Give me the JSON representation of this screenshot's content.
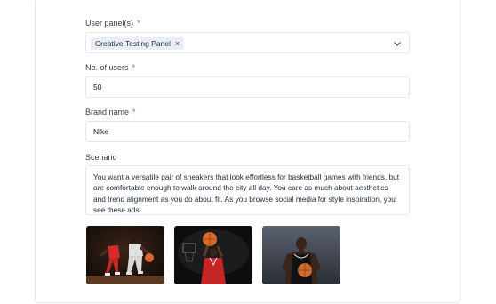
{
  "form": {
    "user_panels": {
      "label": "User panel(s)",
      "chip": "Creative Testing Panel",
      "chip_remove": "×"
    },
    "num_users": {
      "label": "No. of users",
      "value": "50"
    },
    "brand": {
      "label": "Brand name",
      "value": "Nike"
    },
    "scenario": {
      "label": "Scenario",
      "value": "You want a versatile pair of sneakers that look effortless for basketball games with friends, but are comfortable enough to walk around the city all day. You care as much about aesthetics and trend alignment as you do about fit. As you browse social media for style inspiration, you see these ads."
    },
    "required_marker": "*"
  },
  "images": [
    {
      "name": "basketball-players-red-ad-image"
    },
    {
      "name": "basketball-shooter-ad-image"
    },
    {
      "name": "basketball-player-portrait-ad-image"
    }
  ],
  "colors": {
    "required": "#ef4444",
    "chip_bg": "#e8edf6",
    "border": "#e5e7eb"
  }
}
